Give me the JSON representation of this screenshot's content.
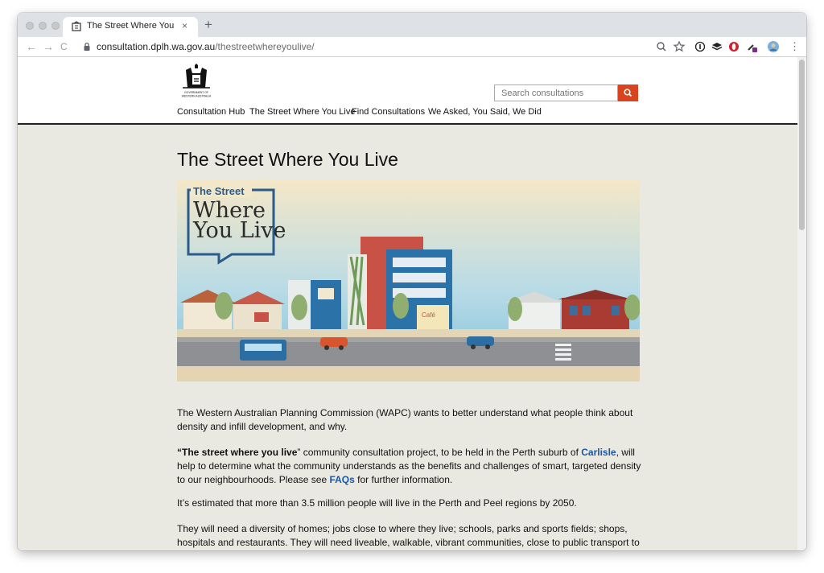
{
  "browser": {
    "tab_title": "The Street Where You Live - W",
    "tab_close": "×",
    "new_tab": "+",
    "url_host": "consultation.dplh.wa.gov.au",
    "url_path": "/thestreetwhereyoulive/",
    "back": "←",
    "forward": "→",
    "reload": "C",
    "menu": "⋮"
  },
  "header": {
    "logo_text_line1": "GOVERNMENT OF",
    "logo_text_line2": "WESTERN AUSTRALIA",
    "search_placeholder": "Search consultations",
    "nav": [
      "Consultation Hub",
      "The Street Where You Live",
      "Find Consultations",
      "We Asked, You Said, We Did"
    ]
  },
  "main": {
    "title": "The Street Where You Live",
    "hero": {
      "logo_line1": "The Street",
      "logo_line2": "Where",
      "logo_line3": "You Live",
      "cafe_sign": "Café"
    },
    "p1": "The Western Australian Planning Commission (WAPC) wants to better understand what people think about density and infill development, and why.",
    "p2_bold": "“The street where you live",
    "p2_a": "” community consultation project, to be held in the Perth suburb of ",
    "p2_link1": "Carlisle",
    "p2_b": ", will help to determine what the community understands as the benefits and challenges of smart, targeted density to our neighbourhoods. Please see ",
    "p2_link2": "FAQs",
    "p2_c": " for further information.",
    "p3": "It’s estimated that more than 3.5 million people will live in the Perth and Peel regions by 2050.",
    "p4": "They will need a diversity of homes; jobs close to where they live; schools, parks and sports fields; shops, hospitals and restaurants. They will need liveable, walkable, vibrant communities, close to public transport to reduce car use and congestion; with trees and open space and protection for the natural environment and heritage places."
  },
  "colors": {
    "search_button": "#d9431e",
    "link": "#1a56a6",
    "page_background": "#e9e8e1"
  }
}
